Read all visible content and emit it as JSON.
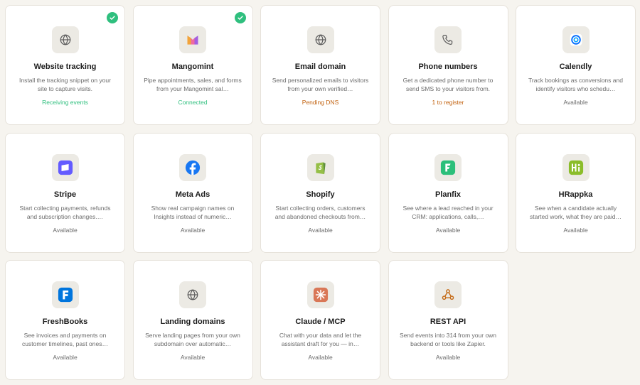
{
  "colors": {
    "background": "#f6f4ef",
    "status_success": "#2fbf7e",
    "status_warning": "#c2620f",
    "status_neutral": "#6b6b6b"
  },
  "integrations": [
    {
      "title": "Website tracking",
      "description": "Install the tracking snippet on your site to capture visits.",
      "status": "Receiving events",
      "status_type": "success",
      "connected": true,
      "icon": "globe-icon"
    },
    {
      "title": "Mangomint",
      "description": "Pipe appointments, sales, and forms from your Mangomint sal…",
      "status": "Connected",
      "status_type": "success",
      "connected": true,
      "icon": "mangomint-logo-icon"
    },
    {
      "title": "Email domain",
      "description": "Send personalized emails to visitors from your own verified…",
      "status": "Pending DNS",
      "status_type": "warning",
      "connected": false,
      "icon": "globe-icon"
    },
    {
      "title": "Phone numbers",
      "description": "Get a dedicated phone number to send SMS to your visitors from.",
      "status": "1 to register",
      "status_type": "warning",
      "connected": false,
      "icon": "phone-icon"
    },
    {
      "title": "Calendly",
      "description": "Track bookings as conversions and identify visitors who schedu…",
      "status": "Available",
      "status_type": "neutral",
      "connected": false,
      "icon": "calendly-logo-icon"
    },
    {
      "title": "Stripe",
      "description": "Start collecting payments, refunds and subscription changes.…",
      "status": "Available",
      "status_type": "neutral",
      "connected": false,
      "icon": "stripe-logo-icon"
    },
    {
      "title": "Meta Ads",
      "description": "Show real campaign names on Insights instead of numeric…",
      "status": "Available",
      "status_type": "neutral",
      "connected": false,
      "icon": "facebook-logo-icon"
    },
    {
      "title": "Shopify",
      "description": "Start collecting orders, customers and abandoned checkouts from…",
      "status": "Available",
      "status_type": "neutral",
      "connected": false,
      "icon": "shopify-logo-icon"
    },
    {
      "title": "Planfix",
      "description": "See where a lead reached in your CRM: applications, calls,…",
      "status": "Available",
      "status_type": "neutral",
      "connected": false,
      "icon": "planfix-logo-icon"
    },
    {
      "title": "HRappka",
      "description": "See when a candidate actually started work, what they are paid…",
      "status": "Available",
      "status_type": "neutral",
      "connected": false,
      "icon": "hrappka-logo-icon"
    },
    {
      "title": "FreshBooks",
      "description": "See invoices and payments on customer timelines, past ones…",
      "status": "Available",
      "status_type": "neutral",
      "connected": false,
      "icon": "freshbooks-logo-icon"
    },
    {
      "title": "Landing domains",
      "description": "Serve landing pages from your own subdomain over automatic…",
      "status": "Available",
      "status_type": "neutral",
      "connected": false,
      "icon": "globe-icon"
    },
    {
      "title": "Claude / MCP",
      "description": "Chat with your data and let the assistant draft for you — in…",
      "status": "Available",
      "status_type": "neutral",
      "connected": false,
      "icon": "claude-logo-icon"
    },
    {
      "title": "REST API",
      "description": "Send events into 314 from your own backend or tools like Zapier.",
      "status": "Available",
      "status_type": "neutral",
      "connected": false,
      "icon": "webhook-icon"
    }
  ]
}
